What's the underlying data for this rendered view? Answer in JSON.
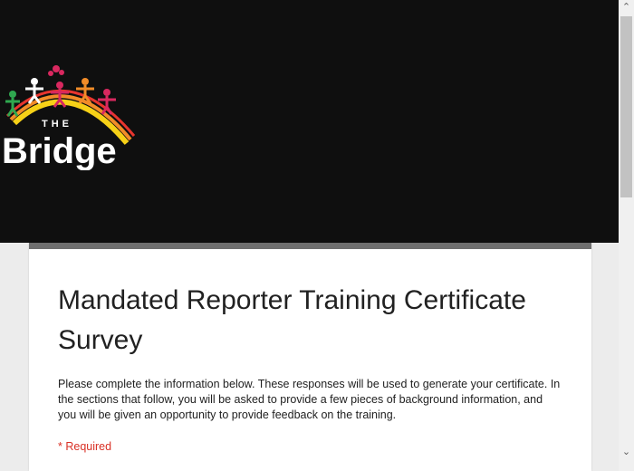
{
  "header": {
    "logo": {
      "wordmark_small": "THE",
      "wordmark_large": "Bridge",
      "icon": "people-rainbow-logo"
    },
    "background_color": "#0f0f0f"
  },
  "form": {
    "title": "Mandated Reporter Training Certificate Survey",
    "description": "Please complete the information below. These responses will be used to generate your certificate. In the sections that follow, you will be asked to provide a few pieces of background information, and you will be given an opportunity to provide feedback on the training.",
    "required_note": "* Required",
    "accent_color": "#6f6f6f",
    "required_color": "#d93025"
  },
  "scrollbar": {
    "up_icon": "chevron-up-icon",
    "down_icon": "chevron-down-icon"
  }
}
